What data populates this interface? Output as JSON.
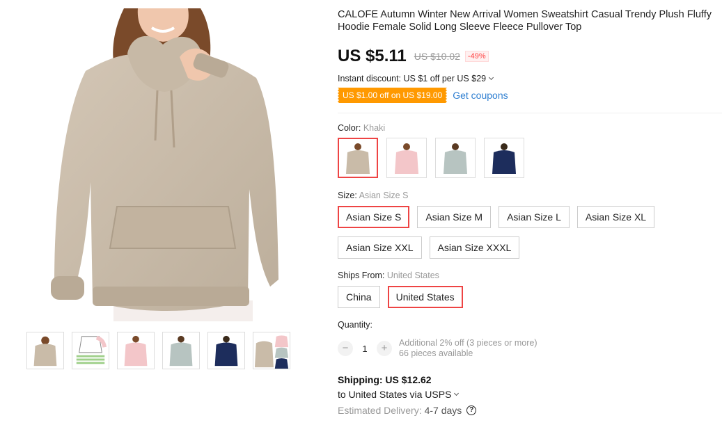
{
  "product": {
    "title": "CALOFE Autumn Winter New Arrival Women Sweatshirt Casual Trendy Plush Fluffy Hoodie Female Solid Long Sleeve Fleece Pullover Top"
  },
  "price": {
    "current": "US $5.11",
    "original": "US $10.02",
    "discount_pct": "-49%"
  },
  "discount": {
    "instant_text": "Instant discount: US $1 off per US $29",
    "coupon_badge": "US $1.00 off on US $19.00",
    "get_coupons": "Get coupons"
  },
  "color": {
    "label": "Color: ",
    "selected": "Khaki",
    "swatches": [
      {
        "name": "Khaki",
        "color": "#c9bba8"
      },
      {
        "name": "Pink",
        "color": "#f3c6c9"
      },
      {
        "name": "Gray",
        "color": "#b7c4c1"
      },
      {
        "name": "Navy",
        "color": "#1d2d5c"
      }
    ]
  },
  "size": {
    "label": "Size: ",
    "selected": "Asian Size S",
    "options": [
      "Asian Size S",
      "Asian Size M",
      "Asian Size L",
      "Asian Size XL",
      "Asian Size XXL",
      "Asian Size XXXL"
    ]
  },
  "ships_from": {
    "label": "Ships From: ",
    "selected": "United States",
    "options": [
      "China",
      "United States"
    ]
  },
  "quantity": {
    "label": "Quantity:",
    "minus": "−",
    "value": "1",
    "plus": "+",
    "note_1": "Additional 2% off (3 pieces or more)",
    "note_2": "66 pieces available"
  },
  "shipping": {
    "title": "Shipping: US $12.62",
    "via": "to United States via USPS",
    "delivery_label": "Estimated Delivery:",
    "delivery_days": "4-7 days",
    "help": "?"
  },
  "colors": {
    "accent_red": "#e44444",
    "coupon_orange": "#ff9900",
    "link_blue": "#2f7fd1",
    "hoodie_khaki": "#c9bba8"
  }
}
